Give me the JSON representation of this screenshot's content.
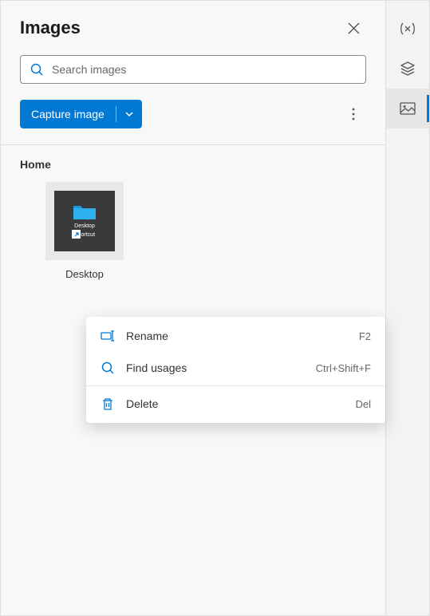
{
  "header": {
    "title": "Images"
  },
  "search": {
    "placeholder": "Search images"
  },
  "toolbar": {
    "capture_label": "Capture image"
  },
  "section": {
    "title": "Home",
    "items": [
      {
        "label": "Desktop",
        "icon_text1": "Desktop",
        "icon_text2": "Shortcut"
      }
    ]
  },
  "context_menu": {
    "items": [
      {
        "label": "Rename",
        "shortcut": "F2",
        "icon": "rename"
      },
      {
        "label": "Find usages",
        "shortcut": "Ctrl+Shift+F",
        "icon": "search"
      },
      {
        "label": "Delete",
        "shortcut": "Del",
        "icon": "delete"
      }
    ]
  },
  "rail": {
    "items": [
      {
        "name": "variables"
      },
      {
        "name": "layers"
      },
      {
        "name": "images"
      }
    ]
  }
}
